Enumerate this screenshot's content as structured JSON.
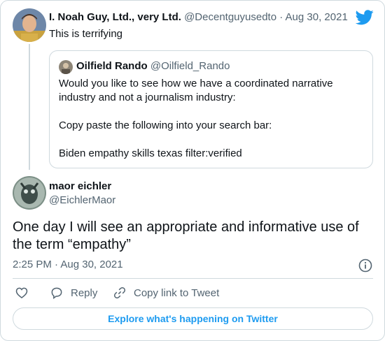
{
  "parent_tweet": {
    "name": "I. Noah Guy, Ltd., very Ltd.",
    "handle_date": "@Decentguyusedto · Aug 30, 2021",
    "text": "This is terrifying"
  },
  "quoted_tweet": {
    "name": "Oilfield Rando",
    "handle": "@Oilfield_Rando",
    "paragraphs": [
      "Would you like to see how we have a coordinated narrative industry and not a journalism industry:",
      "Copy paste the following into your search bar:",
      "Biden empathy skills texas filter:verified"
    ]
  },
  "main_tweet": {
    "name": "maor eichler",
    "handle": "@EichlerMaor",
    "text": "One day I will see an appropriate and informative use of the term “empathy”",
    "timestamp": "2:25 PM · Aug 30, 2021"
  },
  "actions": {
    "reply_label": "Reply",
    "copy_label": "Copy link to Tweet"
  },
  "explore_label": "Explore what's happening on Twitter",
  "colors": {
    "accent": "#1d9bf0",
    "text": "#0f1419",
    "secondary": "#536471",
    "border": "#cfd9de"
  },
  "icons": [
    "twitter-bird-icon",
    "info-icon",
    "heart-icon",
    "reply-bubble-icon",
    "link-icon"
  ]
}
